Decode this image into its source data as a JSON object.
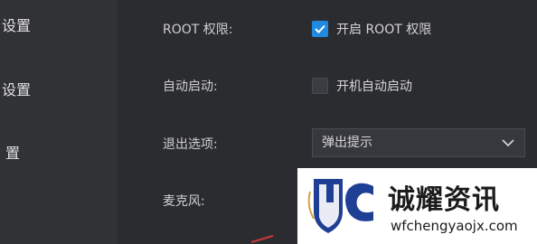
{
  "sidebar": {
    "items": [
      {
        "label": "设置"
      },
      {
        "label": "设置"
      },
      {
        "label": "置"
      }
    ]
  },
  "settings": {
    "root": {
      "label": "ROOT 权限:",
      "checkbox_text": "开启 ROOT 权限",
      "checked": true
    },
    "autostart": {
      "label": "自动启动:",
      "checkbox_text": "开机自动启动",
      "checked": false
    },
    "exit_option": {
      "label": "退出选项:",
      "selected": "弹出提示"
    },
    "microphone": {
      "label": "麦克风:"
    }
  },
  "watermark": {
    "title": "诚耀资讯",
    "url": "wfchengyaojx.com"
  },
  "colors": {
    "accent": "#1f8ae0",
    "background": "#2b2c30",
    "sidebar": "#313236"
  }
}
